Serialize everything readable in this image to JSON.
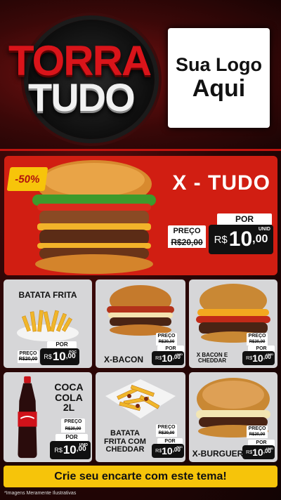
{
  "brand": {
    "line1": "TORRA",
    "line2": "TUDO"
  },
  "logo_box": {
    "line1": "Sua Logo",
    "line2": "Aqui"
  },
  "hero": {
    "badge": "-50%",
    "title": "X - TUDO",
    "old_label": "PREÇO",
    "old_price": "R$20,00",
    "por_label": "POR",
    "currency": "R$",
    "price_int": "10",
    "price_cents": ",00",
    "unit": "UNID"
  },
  "products": [
    {
      "name": "BATATA FRITA",
      "old_label": "PREÇO",
      "old_price": "R$20,00",
      "por_label": "POR",
      "currency": "R$",
      "price_int": "10",
      "price_cents": ",00",
      "unit": "POC"
    },
    {
      "name": "X-BACON",
      "old_label": "PREÇO",
      "old_price": "R$20,00",
      "por_label": "POR",
      "currency": "R$",
      "price_int": "10",
      "price_cents": ",00",
      "unit": "UNID"
    },
    {
      "name": "X BACON E CHEDDAR",
      "old_label": "PREÇO",
      "old_price": "R$20,00",
      "por_label": "POR",
      "currency": "R$",
      "price_int": "10",
      "price_cents": ",00",
      "unit": "UNID"
    },
    {
      "name_l1": "COCA",
      "name_l2": "COLA",
      "name_l3": "2L",
      "old_label": "PREÇO",
      "old_price": "R$20,00",
      "por_label": "POR",
      "currency": "R$",
      "price_int": "10",
      "price_cents": ",00",
      "unit": "UNID"
    },
    {
      "name_l1": "BATATA",
      "name_l2": "FRITA COM",
      "name_l3": "CHEDDAR",
      "old_label": "PREÇO",
      "old_price": "R$20,00",
      "por_label": "POR",
      "currency": "R$",
      "price_int": "10",
      "price_cents": ",00",
      "unit": "POC"
    },
    {
      "name": "X-BURGUER",
      "old_label": "PREÇO",
      "old_price": "R$20,00",
      "por_label": "POR",
      "currency": "R$",
      "price_int": "10",
      "price_cents": ",00",
      "unit": "UNID"
    }
  ],
  "footer": {
    "cta": "Crie seu encarte com este tema!",
    "note": "*Imagens Meramente Ilustrativas"
  },
  "colors": {
    "red": "#d11e12",
    "yellow": "#f6c40a",
    "dark": "#111111",
    "card": "#d6d6d8"
  }
}
